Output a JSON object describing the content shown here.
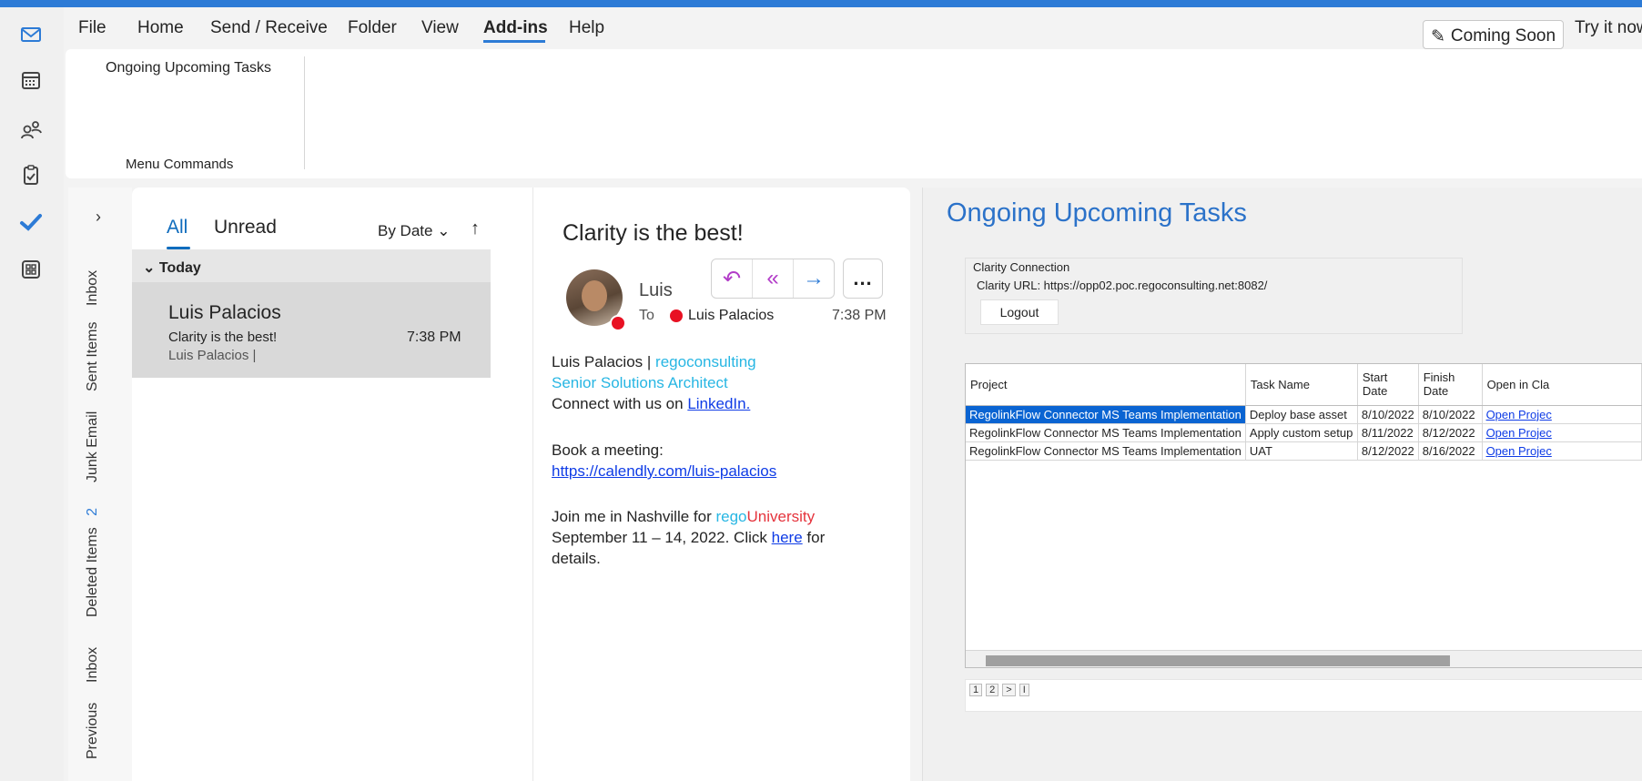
{
  "menu": {
    "items": [
      "File",
      "Home",
      "Send / Receive",
      "Folder",
      "View",
      "Add-ins",
      "Help"
    ],
    "active": "Add-ins",
    "coming_soon": "Coming Soon",
    "try_it": "Try it now"
  },
  "ribbon": {
    "button_label": "Ongoing Upcoming Tasks",
    "group_label": "Menu Commands"
  },
  "folders": {
    "items": [
      "Inbox",
      "Sent Items",
      "Junk Email",
      "Deleted Items",
      "Inbox",
      "Previous"
    ],
    "deleted_count": "2"
  },
  "list": {
    "tab_all": "All",
    "tab_unread": "Unread",
    "sort_label": "By Date",
    "group": "Today",
    "message": {
      "from": "Luis Palacios",
      "subject": "Clarity is the best!",
      "time": "7:38 PM",
      "preview": "Luis Palacios |"
    }
  },
  "reading": {
    "subject": "Clarity is the best!",
    "sender": "Luis",
    "to_label": "To",
    "to_name": "Luis Palacios",
    "time": "7:38 PM",
    "more": "...",
    "sig_name": "Luis Palacios |",
    "sig_company": "regoconsulting",
    "sig_title": "Senior Solutions Architect",
    "connect_prefix": "Connect with us on",
    "connect_link": "LinkedIn.",
    "book": "Book a meeting:",
    "calendly": "https://calendly.com/luis-palacios",
    "join_prefix": "Join me in Nashville for",
    "join_rego": "rego",
    "join_university": "University",
    "dates_prefix": "September 11 – 14, 2022. Click",
    "here_link": "here",
    "dates_suffix": "for",
    "details": "details."
  },
  "panel": {
    "title": "Ongoing Upcoming Tasks",
    "connection_title": "Clarity Connection",
    "connection_url": "Clarity URL: https://opp02.poc.regoconsulting.net:8082/",
    "logout": "Logout",
    "columns": [
      "Project",
      "Task Name",
      "Start Date",
      "Finish Date",
      "Open in Cla"
    ],
    "rows": [
      [
        "RegolinkFlow Connector MS Teams Implementation",
        "Deploy base asset",
        "8/10/2022",
        "8/10/2022",
        "Open Projec"
      ],
      [
        "RegolinkFlow Connector MS Teams Implementation",
        "Apply custom setup",
        "8/11/2022",
        "8/12/2022",
        "Open Projec"
      ],
      [
        "RegolinkFlow Connector MS Teams Implementation",
        "UAT",
        "8/12/2022",
        "8/16/2022",
        "Open Projec"
      ]
    ],
    "pager": [
      "1",
      "2",
      ">",
      "I"
    ]
  },
  "icons": {
    "mail": "mail-icon",
    "calendar": "calendar-icon",
    "people": "people-icon",
    "tasks": "clipboard-icon",
    "todo": "checkmark-icon",
    "apps": "apps-icon"
  },
  "colors": {
    "accent": "#2d7bd6",
    "link": "#0f3ce6",
    "selected_row": "#0a64d2",
    "presence_busy": "#e81123"
  }
}
